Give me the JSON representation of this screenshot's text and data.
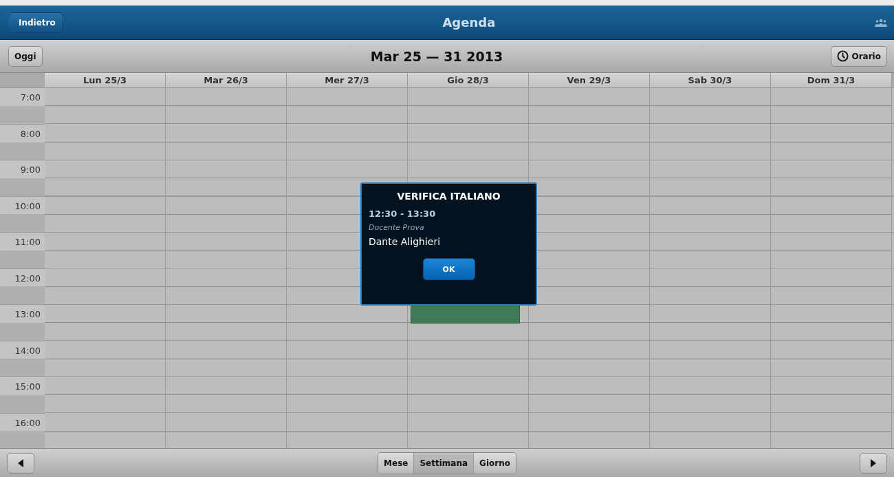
{
  "header": {
    "back": "Indietro",
    "title": "Agenda"
  },
  "toolbar": {
    "today": "Oggi",
    "range": "Mar 25 — 31 2013",
    "schedule": "Orario"
  },
  "days": [
    {
      "label": "Lun 25/3",
      "has_event": false
    },
    {
      "label": "Mar 26/3",
      "has_event": false
    },
    {
      "label": "Mer 27/3",
      "has_event": false
    },
    {
      "label": "Gio 28/3",
      "has_event": true
    },
    {
      "label": "Ven 29/3",
      "has_event": false
    },
    {
      "label": "Sab 30/3",
      "has_event": false
    },
    {
      "label": "Dom 31/3",
      "has_event": false
    }
  ],
  "hours": [
    "7:00",
    "8:00",
    "9:00",
    "10:00",
    "11:00",
    "12:00",
    "13:00",
    "14:00",
    "15:00",
    "16:00"
  ],
  "dialog": {
    "title": "VERIFICA ITALIANO",
    "time": "12:30 - 13:30",
    "teacher": "Docente Prova",
    "subject": "Dante Alighieri",
    "button": "OK"
  },
  "footer": {
    "views": [
      {
        "label": "Mese",
        "selected": false
      },
      {
        "label": "Settimana",
        "selected": true
      },
      {
        "label": "Giorno",
        "selected": false
      }
    ]
  }
}
